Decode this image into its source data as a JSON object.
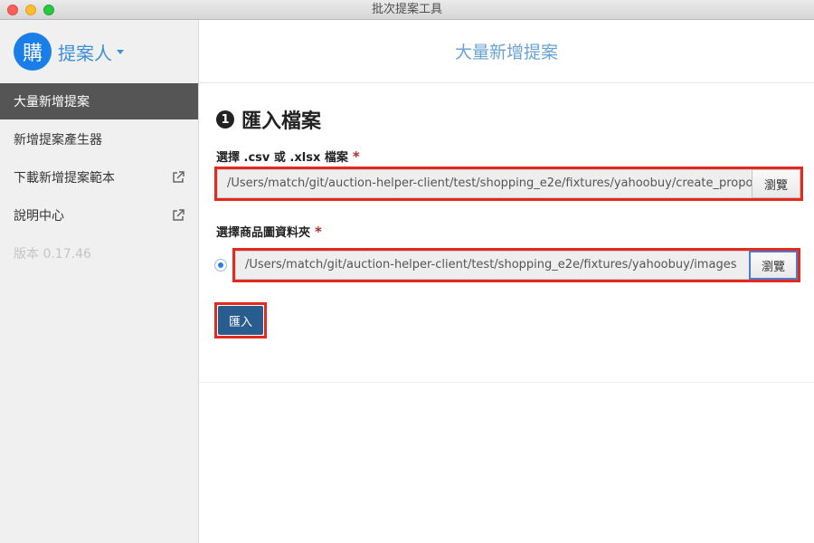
{
  "window": {
    "title": "批次提案工具"
  },
  "sidebar": {
    "avatar_char": "購",
    "brand_name": "提案人",
    "items": [
      {
        "label": "大量新增提案",
        "active": true
      },
      {
        "label": "新增提案產生器"
      },
      {
        "label": "下載新增提案範本",
        "external": true
      },
      {
        "label": "說明中心",
        "external": true
      }
    ],
    "version": "版本 0.17.46"
  },
  "main": {
    "header_title": "大量新增提案",
    "section": {
      "step": "1",
      "title": "匯入檔案"
    },
    "file_field": {
      "label": "選擇 .csv 或 .xlsx 檔案",
      "required_mark": "*",
      "value": "/Users/match/git/auction-helper-client/test/shopping_e2e/fixtures/yahoobuy/create_proposal",
      "browse_label": "瀏覽"
    },
    "folder_field": {
      "label": "選擇商品圖資料夾",
      "required_mark": "*",
      "value": "/Users/match/git/auction-helper-client/test/shopping_e2e/fixtures/yahoobuy/images",
      "browse_label": "瀏覽"
    },
    "import_button": "匯入"
  },
  "colors": {
    "accent": "#1a7ee8",
    "sidebar_active": "#555555",
    "highlight": "#e32a1c",
    "import_button": "#2a5d8f"
  }
}
